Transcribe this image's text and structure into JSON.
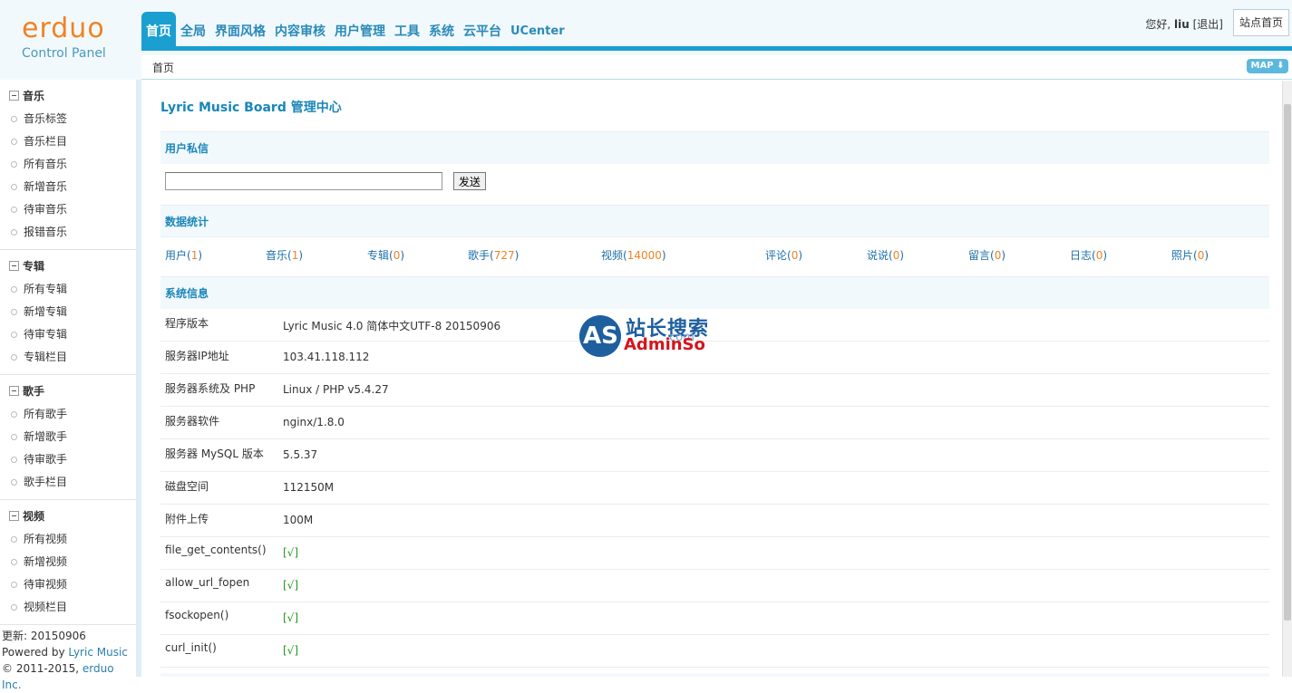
{
  "logo": {
    "brand": "erduo",
    "subtitle": "Control Panel"
  },
  "nav": {
    "tabs": [
      {
        "label": "首页",
        "active": true
      },
      {
        "label": "全局"
      },
      {
        "label": "界面风格"
      },
      {
        "label": "内容审核"
      },
      {
        "label": "用户管理"
      },
      {
        "label": "工具"
      },
      {
        "label": "系统"
      },
      {
        "label": "云平台"
      },
      {
        "label": "UCenter"
      }
    ]
  },
  "user": {
    "greeting": "您好,",
    "name": "liu",
    "logout": "[退出]",
    "site_home": "站点首页"
  },
  "breadcrumb": "首页",
  "map_button": "MAP",
  "sidebar": {
    "groups": [
      {
        "title": "音乐",
        "items": [
          "音乐标签",
          "音乐栏目",
          "所有音乐",
          "新增音乐",
          "待审音乐",
          "报错音乐"
        ]
      },
      {
        "title": "专辑",
        "items": [
          "所有专辑",
          "新增专辑",
          "待审专辑",
          "专辑栏目"
        ]
      },
      {
        "title": "歌手",
        "items": [
          "所有歌手",
          "新增歌手",
          "待审歌手",
          "歌手栏目"
        ]
      },
      {
        "title": "视频",
        "items": [
          "所有视频",
          "新增视频",
          "待审视频",
          "视频栏目"
        ]
      }
    ],
    "footer": {
      "update": "更新: 20150906",
      "powered_prefix": "Powered by ",
      "powered_link": "Lyric Music",
      "copyright_prefix": "© 2011-2015, ",
      "copyright_link": "erduo Inc."
    }
  },
  "main": {
    "title": "Lyric Music Board 管理中心",
    "sections": {
      "pm": "用户私信",
      "stats": "数据统计",
      "sysinfo": "系统信息"
    },
    "pm": {
      "input_value": "",
      "send_label": "发送"
    },
    "stats": [
      {
        "label": "用户",
        "value": "1"
      },
      {
        "label": "音乐",
        "value": "1"
      },
      {
        "label": "专辑",
        "value": "0"
      },
      {
        "label": "歌手",
        "value": "727"
      },
      {
        "label": "视频",
        "value": "14000"
      },
      {
        "label": "评论",
        "value": "0"
      },
      {
        "label": "说说",
        "value": "0"
      },
      {
        "label": "留言",
        "value": "0"
      },
      {
        "label": "日志",
        "value": "0"
      },
      {
        "label": "照片",
        "value": "0"
      }
    ],
    "sysinfo": [
      {
        "label": "程序版本",
        "value": "Lyric Music 4.0 简体中文UTF-8 20150906"
      },
      {
        "label": "服务器IP地址",
        "value": "103.41.118.112"
      },
      {
        "label": "服务器系统及 PHP",
        "value": "Linux / PHP v5.4.27"
      },
      {
        "label": "服务器软件",
        "value": "nginx/1.8.0"
      },
      {
        "label": "服务器 MySQL 版本",
        "value": "5.5.37"
      },
      {
        "label": "磁盘空间",
        "value": "112150M"
      },
      {
        "label": "附件上传",
        "value": "100M"
      },
      {
        "label": "file_get_contents()",
        "value": "[√]",
        "ok": true
      },
      {
        "label": "allow_url_fopen",
        "value": "[√]",
        "ok": true
      },
      {
        "label": "fsockopen()",
        "value": "[√]",
        "ok": true
      },
      {
        "label": "curl_init()",
        "value": "[√]",
        "ok": true
      }
    ]
  },
  "watermark": {
    "circle": "AS",
    "cn": "站长搜索",
    "en": "AdminSo",
    "com": ".com"
  },
  "colors": {
    "accent": "#1a9fd0",
    "link": "#1a6fa8",
    "number": "#f08222",
    "ok": "#1a9a1a",
    "brand": "#f08222"
  }
}
